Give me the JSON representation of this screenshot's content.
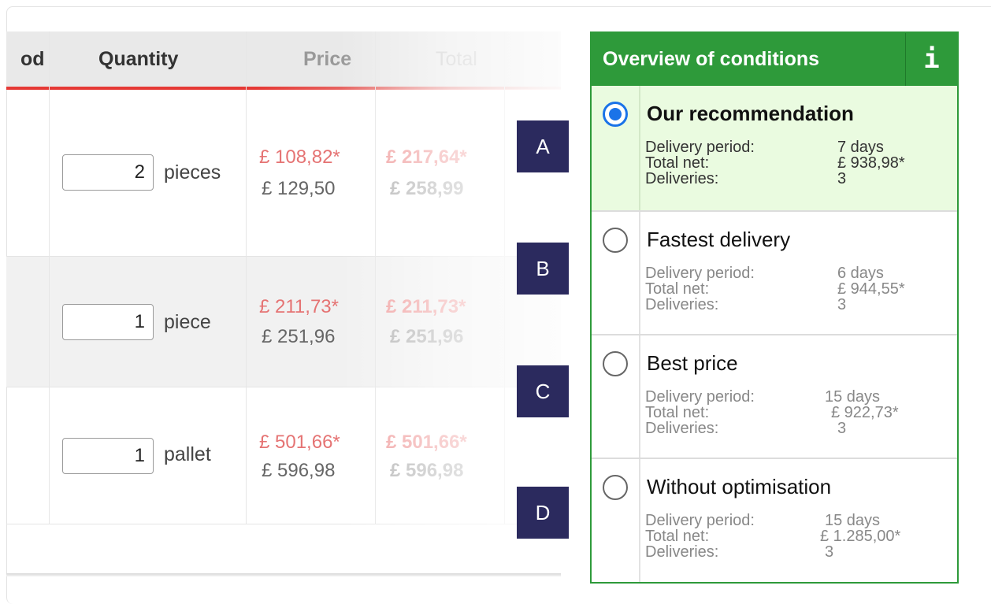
{
  "table": {
    "headers": {
      "method": "od",
      "quantity": "Quantity",
      "price": "Price",
      "total": "Total"
    },
    "rows": [
      {
        "qty": "2",
        "unit": "pieces",
        "price_net": "£ 108,82*",
        "price_gross": "£ 129,50",
        "total_net": "£ 217,64*",
        "total_gross": "£ 258,99"
      },
      {
        "qty": "1",
        "unit": "piece",
        "price_net": "£ 211,73*",
        "price_gross": "£ 251,96",
        "total_net": "£ 211,73*",
        "total_gross": "£ 251,96"
      },
      {
        "qty": "1",
        "unit": "pallet",
        "price_net": "£ 501,66*",
        "price_gross": "£ 596,98",
        "total_net": "£ 501,66*",
        "total_gross": "£ 596,98"
      }
    ]
  },
  "markers": [
    "A",
    "B",
    "C",
    "D"
  ],
  "conditions": {
    "title": "Overview of conditions",
    "info_icon": "i",
    "labels": {
      "period": "Delivery period:",
      "total": "Total net:",
      "deliveries": "Deliveries:"
    },
    "options": [
      {
        "title": "Our recommendation",
        "selected": true,
        "period": "7 days",
        "total": "£ 938,98*",
        "deliveries": "3"
      },
      {
        "title": "Fastest delivery",
        "selected": false,
        "period": "6 days",
        "total": "£ 944,55*",
        "deliveries": "3"
      },
      {
        "title": "Best price",
        "selected": false,
        "period": "15 days",
        "total": "£ 922,73*",
        "deliveries": "3"
      },
      {
        "title": "Without optimisation",
        "selected": false,
        "period": "15 days",
        "total": "£ 1.285,00*",
        "deliveries": "3"
      }
    ]
  },
  "colors": {
    "accent_green": "#2e9a3a",
    "selected_bg": "#eafbe0",
    "marker_bg": "#2b2a5e",
    "price_red": "#e57373",
    "radio_blue": "#1a73e8"
  }
}
